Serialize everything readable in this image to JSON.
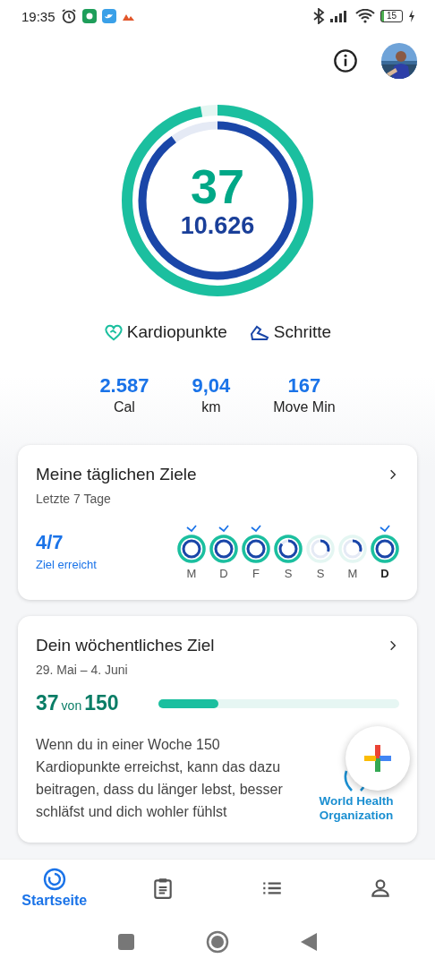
{
  "status_bar": {
    "time": "19:35",
    "battery": "15"
  },
  "rings": {
    "cardio_points": "37",
    "steps": "10.626"
  },
  "legend": [
    {
      "kind": "heart",
      "label": "Kardiopunkte"
    },
    {
      "kind": "shoe",
      "label": "Schritte"
    }
  ],
  "stats": [
    {
      "value": "2.587",
      "label": "Cal"
    },
    {
      "value": "9,04",
      "label": "km"
    },
    {
      "value": "167",
      "label": "Move Min"
    }
  ],
  "daily_goals": {
    "title": "Meine täglichen Ziele",
    "subtitle": "Letzte 7 Tage",
    "score": "4/7",
    "score_label": "Ziel erreicht",
    "days": [
      {
        "label": "M",
        "checked": true,
        "today": false,
        "kind": "complete"
      },
      {
        "label": "D",
        "checked": true,
        "today": false,
        "kind": "complete"
      },
      {
        "label": "F",
        "checked": true,
        "today": false,
        "kind": "complete"
      },
      {
        "label": "S",
        "checked": false,
        "today": false,
        "kind": "cardio"
      },
      {
        "label": "S",
        "checked": false,
        "today": false,
        "kind": "low"
      },
      {
        "label": "M",
        "checked": false,
        "today": false,
        "kind": "low"
      },
      {
        "label": "D",
        "checked": true,
        "today": true,
        "kind": "complete"
      }
    ]
  },
  "weekly_goal": {
    "title": "Dein wöchentliches Ziel",
    "date_range": "29. Mai – 4. Juni",
    "current": "37",
    "connector": "von",
    "target": "150",
    "level": 0.25,
    "text": "Wenn du in einer Woche 150 Kardiopunkte erreichst, kann das dazu beitragen, dass du länger lebst, besser schläfst und dich wohler fühlst",
    "source": "World Health Organization"
  },
  "bottom_nav": [
    {
      "kind": "home",
      "label": "Startseite",
      "selected": true
    },
    {
      "kind": "journal",
      "selected": false
    },
    {
      "kind": "browse",
      "selected": false
    },
    {
      "kind": "profile",
      "selected": false
    }
  ]
}
